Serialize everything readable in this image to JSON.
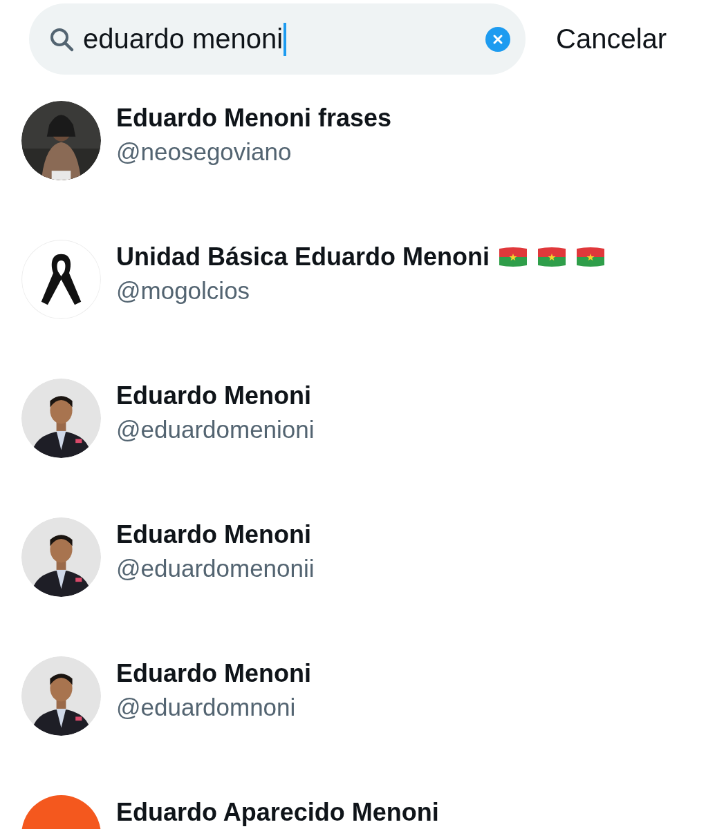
{
  "search": {
    "value": "eduardo menoni",
    "cancel": "Cancelar"
  },
  "results": [
    {
      "name": "Eduardo Menoni frases",
      "handle": "@neosegoviano",
      "avatar": {
        "kind": "photo-dark"
      }
    },
    {
      "name": "Unidad Básica Eduardo Menoni",
      "handle": "@mogolcios",
      "avatar": {
        "kind": "ribbon"
      },
      "badges": [
        {
          "kind": "flag"
        },
        {
          "kind": "flag"
        },
        {
          "kind": "flag"
        }
      ]
    },
    {
      "name": "Eduardo Menoni",
      "handle": "@eduardomenioni"
    },
    {
      "name": "Eduardo Menoni",
      "handle": "@eduardomenonii"
    },
    {
      "name": "Eduardo Menoni",
      "handle": "@eduardomnoni"
    },
    {
      "name": "Eduardo Aparecido Menoni",
      "avatar": {
        "kind": "plain",
        "color": "#f4581e"
      }
    }
  ]
}
